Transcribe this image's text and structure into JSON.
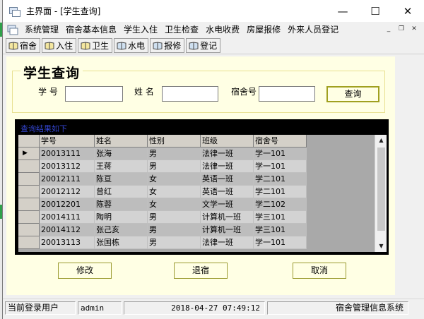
{
  "window": {
    "title": "主界面 - [学生查询]",
    "minimize_glyph": "—",
    "maximize_glyph": "☐",
    "close_glyph": "✕"
  },
  "menu": {
    "items": [
      "系统管理",
      "宿舍基本信息",
      "学生入住",
      "卫生检查",
      "水电收费",
      "房屋报修",
      "外来人员登记"
    ],
    "mdi_min": "_",
    "mdi_restore": "❐",
    "mdi_close": "✕"
  },
  "toolbar": {
    "items": [
      {
        "label": "宿舍",
        "icon": "dormitory-icon"
      },
      {
        "label": "入住",
        "icon": "checkin-icon"
      },
      {
        "label": "卫生",
        "icon": "hygiene-icon"
      },
      {
        "label": "水电",
        "icon": "utility-icon"
      },
      {
        "label": "报修",
        "icon": "repair-icon"
      },
      {
        "label": "登记",
        "icon": "register-icon"
      }
    ]
  },
  "search": {
    "title": "学生查询",
    "student_id_label": "学  号",
    "name_label": "姓  名",
    "dorm_label": "宿舍号",
    "student_id_value": "",
    "name_value": "",
    "dorm_value": "",
    "button_label": "查询"
  },
  "grid": {
    "caption": "查询结果如下",
    "columns": [
      "学号",
      "姓名",
      "性别",
      "班级",
      "宿舍号"
    ],
    "current_row_marker": "▶",
    "rows": [
      [
        "20013111",
        "张海",
        "男",
        "法律一班",
        "学一101"
      ],
      [
        "20013112",
        "王蒋",
        "男",
        "法律一班",
        "学一101"
      ],
      [
        "20012111",
        "陈亘",
        "女",
        "英语一班",
        "学二101"
      ],
      [
        "20012112",
        "曾红",
        "女",
        "英语一班",
        "学二101"
      ],
      [
        "20012201",
        "陈蓉",
        "女",
        "文学一班",
        "学二102"
      ],
      [
        "20014111",
        "陶明",
        "男",
        "计算机一班",
        "学三101"
      ],
      [
        "20014112",
        "张己亥",
        "男",
        "计算机一班",
        "学三101"
      ],
      [
        "20013113",
        "张国栋",
        "男",
        "法律一班",
        "学一101"
      ]
    ]
  },
  "actions": {
    "modify": "修改",
    "checkout": "退宿",
    "cancel": "取消"
  },
  "status": {
    "user_label": "当前登录用户",
    "user": "admin",
    "datetime": "2018-04-27 07:49:12",
    "system_name": "宿舍管理信息系统"
  }
}
